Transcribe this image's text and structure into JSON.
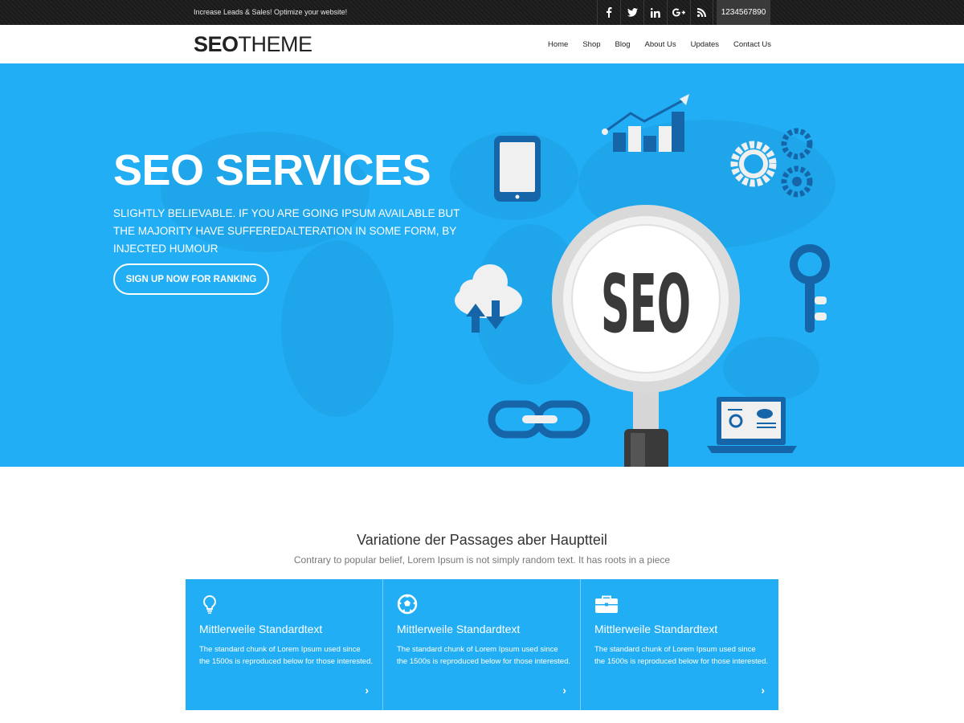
{
  "topbar": {
    "tagline": "Increase Leads & Sales! Optimize your website!",
    "social": [
      {
        "icon": "facebook-icon",
        "glyph": "f"
      },
      {
        "icon": "twitter-icon",
        "glyph": "t"
      },
      {
        "icon": "linkedin-icon",
        "glyph": "in"
      },
      {
        "icon": "google-plus-icon",
        "glyph": "G+"
      },
      {
        "icon": "rss-icon",
        "glyph": "rss"
      }
    ],
    "phone": "1234567890"
  },
  "header": {
    "logo_bold": "SEO",
    "logo_light": "THEME",
    "nav": [
      "Home",
      "Shop",
      "Blog",
      "About Us",
      "Updates",
      "Contact Us"
    ]
  },
  "hero": {
    "title": "SEO SERVICES",
    "subtitle": "Slightly believable. If you are going ipsum available but the majority have sufferedalteration in some form, by injected humour",
    "cta": "SIGN UP NOW FOR RANKING",
    "magnifier_text": "SEO"
  },
  "section": {
    "title": "Variatione der Passages aber Hauptteil",
    "subtitle": "Contrary to popular belief, Lorem Ipsum is not simply random text. It has roots in a piece"
  },
  "cards": [
    {
      "icon": "lightbulb-icon",
      "title": "Mittlerweile Standardtext",
      "text": "The standard chunk of Lorem Ipsum used since the 1500s is reproduced below for those interested."
    },
    {
      "icon": "soccer-ball-icon",
      "title": "Mittlerweile Standardtext",
      "text": "The standard chunk of Lorem Ipsum used since the 1500s is reproduced below for those interested."
    },
    {
      "icon": "briefcase-icon",
      "title": "Mittlerweile Standardtext",
      "text": "The standard chunk of Lorem Ipsum used since the 1500s is reproduced below for those interested."
    }
  ],
  "colors": {
    "accent": "#22aef4",
    "dark_blue": "#1565a8",
    "topbar": "#1e1e1e"
  }
}
